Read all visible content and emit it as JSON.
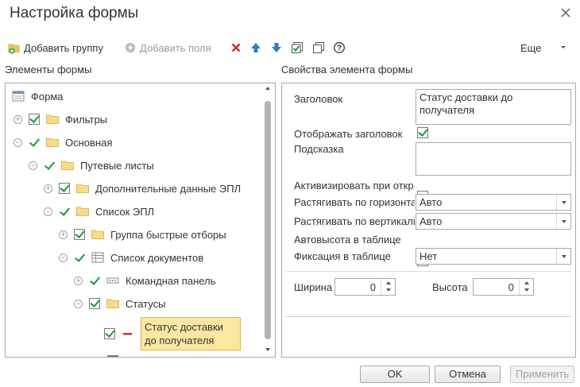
{
  "window": {
    "title": "Настройка формы"
  },
  "toolbar": {
    "add_group": "Добавить группу",
    "add_fields": "Добавить поля",
    "more": "Еще"
  },
  "left_panel": {
    "title": "Элементы формы",
    "tree": [
      {
        "label": "Форма",
        "icon": "form-icon",
        "checked": null,
        "expander": null
      },
      {
        "label": "Фильтры",
        "icon": "folder-icon",
        "checked": "box",
        "expander": "plus"
      },
      {
        "label": "Основная",
        "icon": "folder-icon",
        "checked": "tick",
        "expander": "minus"
      },
      {
        "label": "Путевые листы",
        "icon": "folder-icon",
        "checked": "tick",
        "expander": "minus"
      },
      {
        "label": "Дополнительные данные ЭПЛ",
        "icon": "folder-icon",
        "checked": "box",
        "expander": "plus"
      },
      {
        "label": "Список ЭПЛ",
        "icon": "folder-icon",
        "checked": "tick",
        "expander": "minus"
      },
      {
        "label": "Группа быстрые отборы",
        "icon": "folder-icon",
        "checked": "box",
        "expander": "plus"
      },
      {
        "label": "Список документов",
        "icon": "table-icon",
        "checked": "tick",
        "expander": "minus"
      },
      {
        "label": "Командная панель",
        "icon": "command-panel-icon",
        "checked": "tick",
        "expander": "plus"
      },
      {
        "label": "Статусы",
        "icon": "folder-icon",
        "checked": "box",
        "expander": "minus"
      },
      {
        "label": "Статус доставки до получателя",
        "icon": "field-icon",
        "checked": "box",
        "expander": null,
        "selected": true
      }
    ]
  },
  "right_panel": {
    "title": "Свойства элемента формы",
    "header_label": "Заголовок",
    "header_value": "Статус доставки до получателя",
    "show_header_label": "Отображать заголовок",
    "show_header_checked": true,
    "tooltip_label": "Подсказка",
    "tooltip_value": "",
    "activate_label": "Активизировать при открытии",
    "activate_checked": false,
    "stretch_h_label": "Растягивать по горизонтали",
    "stretch_h_value": "Авто",
    "stretch_v_label": "Растягивать по вертикали",
    "stretch_v_value": "Авто",
    "autoheight_label": "Автовысота в таблице",
    "autoheight_checked": false,
    "fixation_label": "Фиксация в таблице",
    "fixation_value": "Нет",
    "width_label": "Ширина",
    "width_value": "0",
    "height_label": "Высота",
    "height_value": "0"
  },
  "footer": {
    "ok": "OK",
    "cancel": "Отмена",
    "apply": "Применить"
  },
  "colors": {
    "check_green": "#1a9a3a",
    "folder_yellow": "#f3c85a",
    "selection_bg": "#fbe7a1",
    "delete_red": "#d9262a",
    "arrow_blue": "#2e7bd6"
  }
}
